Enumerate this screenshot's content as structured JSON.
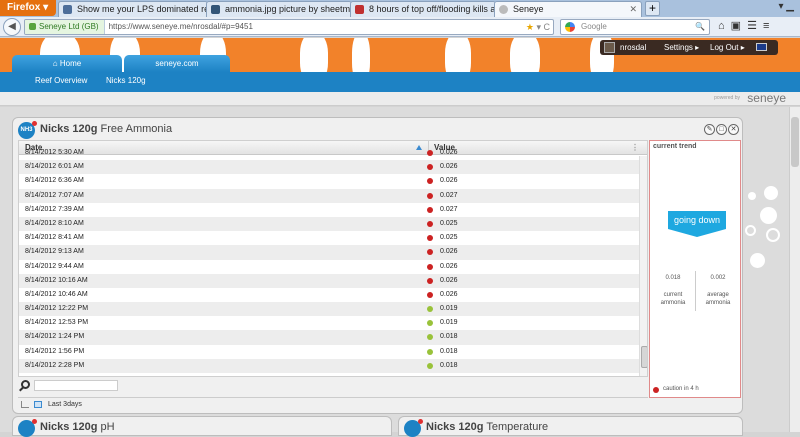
{
  "browser": {
    "app_button": "Firefox",
    "tabs": [
      {
        "label": "Show me your LPS dominated reefta..."
      },
      {
        "label": "ammonia.jpg picture by sheetmetal -..."
      },
      {
        "label": "8 hours of top off/flooding kills almo..."
      },
      {
        "label": "Seneye"
      }
    ],
    "new_tab": "+",
    "site_identity": "Seneye Ltd (GB)",
    "url": "https://www.seneye.me/nrosdal/#p=9451",
    "search_engine": "Google",
    "search_placeholder": "Google"
  },
  "header": {
    "username": "nrosdal",
    "settings": "Settings",
    "logout": "Log Out"
  },
  "nav": {
    "tabs": [
      {
        "label": "Home"
      },
      {
        "label": "seneye.com"
      }
    ],
    "subnav": [
      {
        "label": "Reef Overview"
      },
      {
        "label": "Nicks 120g"
      }
    ],
    "powered_by": "powered by",
    "logo": "seneye"
  },
  "widget": {
    "badge": "NH3",
    "title_device": "Nicks 120g",
    "title_param": "Free Ammonia",
    "columns": {
      "date": "Date",
      "value": "Value"
    },
    "rows": [
      {
        "date": "8/14/2012 5:30 AM",
        "value": "0.026",
        "status": "red"
      },
      {
        "date": "8/14/2012 6:01 AM",
        "value": "0.026",
        "status": "red"
      },
      {
        "date": "8/14/2012 6:36 AM",
        "value": "0.026",
        "status": "red"
      },
      {
        "date": "8/14/2012 7:07 AM",
        "value": "0.027",
        "status": "red"
      },
      {
        "date": "8/14/2012 7:39 AM",
        "value": "0.027",
        "status": "red"
      },
      {
        "date": "8/14/2012 8:10 AM",
        "value": "0.025",
        "status": "red"
      },
      {
        "date": "8/14/2012 8:41 AM",
        "value": "0.025",
        "status": "red"
      },
      {
        "date": "8/14/2012 9:13 AM",
        "value": "0.026",
        "status": "red"
      },
      {
        "date": "8/14/2012 9:44 AM",
        "value": "0.026",
        "status": "red"
      },
      {
        "date": "8/14/2012 10:16 AM",
        "value": "0.026",
        "status": "red"
      },
      {
        "date": "8/14/2012 10:46 AM",
        "value": "0.026",
        "status": "red"
      },
      {
        "date": "8/14/2012 12:22 PM",
        "value": "0.019",
        "status": "green"
      },
      {
        "date": "8/14/2012 12:53 PM",
        "value": "0.019",
        "status": "green"
      },
      {
        "date": "8/14/2012 1:24 PM",
        "value": "0.018",
        "status": "green"
      },
      {
        "date": "8/14/2012 1:56 PM",
        "value": "0.018",
        "status": "green"
      },
      {
        "date": "8/14/2012 2:28 PM",
        "value": "0.018",
        "status": "green"
      }
    ],
    "footer_label": "Last 3days",
    "search_value": ""
  },
  "trend": {
    "title": "current trend",
    "status": "going down",
    "current_value": "0.018",
    "current_label": "current ammonia",
    "average_value": "0.002",
    "average_label": "average ammonia",
    "caution": "caution in 4 h"
  },
  "bottom_widgets": [
    {
      "device": "Nicks 120g",
      "param": "pH"
    },
    {
      "device": "Nicks 120g",
      "param": "Temperature"
    }
  ],
  "colors": {
    "status_red": "#cc2222",
    "status_green": "#99c23a",
    "accent_blue": "#1d82c4",
    "trend_blue": "#1ea8e0",
    "header_orange": "#f2822a"
  }
}
